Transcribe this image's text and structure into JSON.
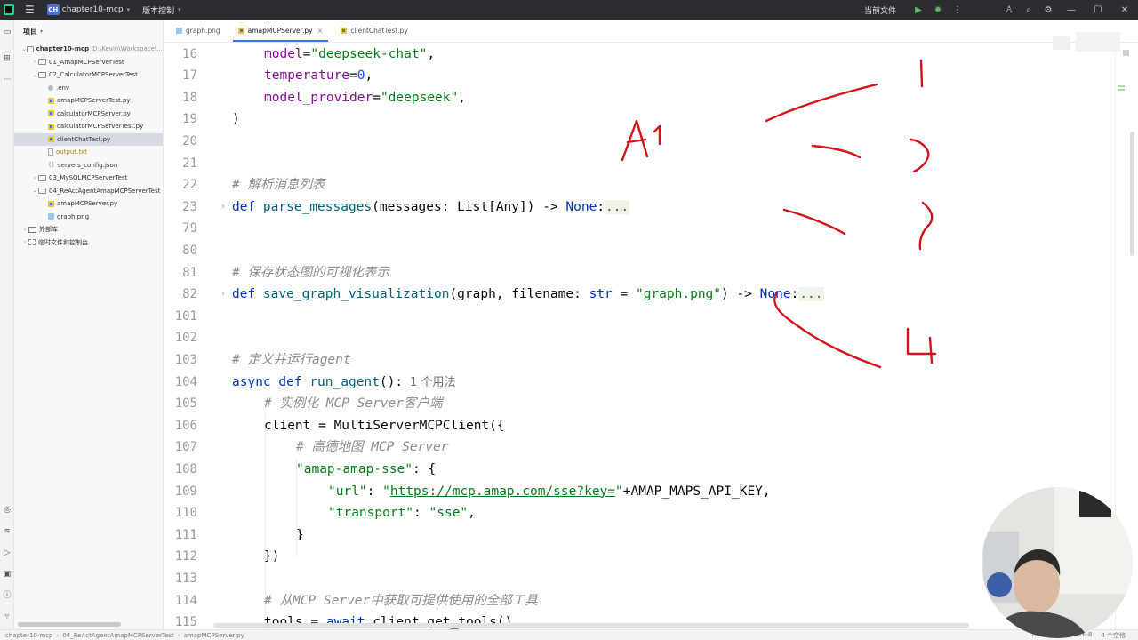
{
  "titlebar": {
    "project_badge": "CH",
    "project_name": "chapter10-mcp",
    "vcs_label": "版本控制",
    "run_config": "当前文件"
  },
  "project_panel": {
    "title": "项目",
    "tree": [
      {
        "label": "chapter10-mcp",
        "path": "D:\\Kevin\\Workspace\\...",
        "type": "folder",
        "level": 0,
        "expanded": true,
        "bold": true
      },
      {
        "label": "01_AmapMCPServerTest",
        "type": "folder",
        "level": 1,
        "expanded": false
      },
      {
        "label": "02_CalculatorMCPServerTest",
        "type": "folder",
        "level": 1,
        "expanded": true
      },
      {
        "label": ".env",
        "type": "env",
        "level": 2
      },
      {
        "label": "amapMCPServerTest.py",
        "type": "py",
        "level": 2
      },
      {
        "label": "calculatorMCPServer.py",
        "type": "py",
        "level": 2
      },
      {
        "label": "calculatorMCPServerTest.py",
        "type": "py",
        "level": 2
      },
      {
        "label": "clientChatTest.py",
        "type": "py",
        "level": 2,
        "selected": true
      },
      {
        "label": "output.txt",
        "type": "txt",
        "level": 2
      },
      {
        "label": "servers_config.json",
        "type": "json",
        "level": 2
      },
      {
        "label": "03_MySQLMCPServerTest",
        "type": "folder",
        "level": 1,
        "expanded": false
      },
      {
        "label": "04_ReActAgentAmapMCPServerTest",
        "type": "folder",
        "level": 1,
        "expanded": true
      },
      {
        "label": "amapMCPServer.py",
        "type": "py",
        "level": 2
      },
      {
        "label": "graph.png",
        "type": "png",
        "level": 2
      },
      {
        "label": "外部库",
        "type": "lib",
        "level": 0,
        "expanded": false
      },
      {
        "label": "临时文件和控制台",
        "type": "scratch",
        "level": 0,
        "expanded": false
      }
    ]
  },
  "tabs": [
    {
      "label": "graph.png",
      "type": "png",
      "active": false
    },
    {
      "label": "amapMCPServer.py",
      "type": "py",
      "active": true
    },
    {
      "label": "clientChatTest.py",
      "type": "py",
      "active": false
    }
  ],
  "editor": {
    "lines": [
      {
        "n": "16",
        "indent": 1,
        "tokens": [
          [
            "p",
            "model"
          ],
          [
            "t",
            "="
          ],
          [
            "s",
            "\"deepseek-chat\""
          ],
          [
            "t",
            ","
          ]
        ]
      },
      {
        "n": "17",
        "indent": 1,
        "tokens": [
          [
            "p",
            "temperature"
          ],
          [
            "t",
            "="
          ],
          [
            "n",
            "0"
          ],
          [
            "t",
            ","
          ]
        ]
      },
      {
        "n": "18",
        "indent": 1,
        "tokens": [
          [
            "p",
            "model_provider"
          ],
          [
            "t",
            "="
          ],
          [
            "s",
            "\"deepseek\""
          ],
          [
            "t",
            ","
          ]
        ]
      },
      {
        "n": "19",
        "indent": 0,
        "tokens": [
          [
            "t",
            ")"
          ]
        ]
      },
      {
        "n": "20",
        "indent": 0,
        "tokens": []
      },
      {
        "n": "21",
        "indent": 0,
        "tokens": []
      },
      {
        "n": "22",
        "indent": 0,
        "tokens": [
          [
            "c",
            "# 解析消息列表"
          ]
        ]
      },
      {
        "n": "23",
        "indent": 0,
        "fold": true,
        "tokens": [
          [
            "k",
            "def "
          ],
          [
            "f",
            "parse_messages"
          ],
          [
            "t",
            "(messages: List[Any]) -> "
          ],
          [
            "k",
            "None"
          ],
          [
            "t",
            ":"
          ],
          [
            "d",
            "..."
          ]
        ]
      },
      {
        "n": "79",
        "indent": 0,
        "tokens": []
      },
      {
        "n": "80",
        "indent": 0,
        "tokens": []
      },
      {
        "n": "81",
        "indent": 0,
        "tokens": [
          [
            "c",
            "# 保存状态图的可视化表示"
          ]
        ]
      },
      {
        "n": "82",
        "indent": 0,
        "fold": true,
        "tokens": [
          [
            "k",
            "def "
          ],
          [
            "f",
            "save_graph_visualization"
          ],
          [
            "t",
            "(graph, filename: "
          ],
          [
            "k",
            "str"
          ],
          [
            "t",
            " = "
          ],
          [
            "s",
            "\"graph.png\""
          ],
          [
            "t",
            ") -> "
          ],
          [
            "k",
            "None"
          ],
          [
            "t",
            ":"
          ],
          [
            "d",
            "..."
          ]
        ]
      },
      {
        "n": "101",
        "indent": 0,
        "tokens": []
      },
      {
        "n": "102",
        "indent": 0,
        "tokens": []
      },
      {
        "n": "103",
        "indent": 0,
        "tokens": [
          [
            "c",
            "# 定义并运行agent"
          ]
        ]
      },
      {
        "n": "104",
        "indent": 0,
        "tokens": [
          [
            "k",
            "async def "
          ],
          [
            "f",
            "run_agent"
          ],
          [
            "t",
            "():"
          ],
          [
            "h",
            "1 个用法"
          ]
        ]
      },
      {
        "n": "105",
        "indent": 1,
        "tokens": [
          [
            "c",
            "# 实例化 MCP Server客户端"
          ]
        ]
      },
      {
        "n": "106",
        "indent": 1,
        "tokens": [
          [
            "t",
            "client = MultiServerMCPClient({"
          ]
        ]
      },
      {
        "n": "107",
        "indent": 2,
        "tokens": [
          [
            "c",
            "# 高德地图 MCP Server"
          ]
        ]
      },
      {
        "n": "108",
        "indent": 2,
        "tokens": [
          [
            "s",
            "\"amap-amap-sse\""
          ],
          [
            "t",
            ": {"
          ]
        ]
      },
      {
        "n": "109",
        "indent": 3,
        "tokens": [
          [
            "s",
            "\"url\""
          ],
          [
            "t",
            ": "
          ],
          [
            "s",
            "\""
          ],
          [
            "l",
            "https://mcp.amap.com/sse?key="
          ],
          [
            "s",
            "\""
          ],
          [
            "t",
            "+AMAP_MAPS_API_KEY,"
          ]
        ]
      },
      {
        "n": "110",
        "indent": 3,
        "tokens": [
          [
            "s",
            "\"transport\""
          ],
          [
            "t",
            ": "
          ],
          [
            "s",
            "\"sse\""
          ],
          [
            "t",
            ","
          ]
        ]
      },
      {
        "n": "111",
        "indent": 2,
        "tokens": [
          [
            "t",
            "}"
          ]
        ]
      },
      {
        "n": "112",
        "indent": 1,
        "tokens": [
          [
            "t",
            "})"
          ]
        ]
      },
      {
        "n": "113",
        "indent": 0,
        "tokens": []
      },
      {
        "n": "114",
        "indent": 1,
        "tokens": [
          [
            "c",
            "# 从MCP Server中获取可提供使用的全部工具"
          ]
        ]
      },
      {
        "n": "115",
        "indent": 1,
        "tokens": [
          [
            "t",
            "tools = "
          ],
          [
            "k",
            "await "
          ],
          [
            "t",
            "client.get_tools()"
          ]
        ]
      }
    ]
  },
  "annotations": {
    "label_a1": "A1",
    "mark_1": "1",
    "mark_2": "2",
    "mark_3": "3",
    "mark_4": "4",
    "ink_color": "#d4141b"
  },
  "statusbar": {
    "crumbs": [
      "chapter10-mcp",
      "04_ReActAgentAmapMCPServerTest",
      "amapMCPServer.py"
    ],
    "right": [
      "1:1",
      "CRLF",
      "UTF-8",
      "4 个空格"
    ]
  },
  "colors": {
    "accent": "#3574f0",
    "keyword": "#0033b3",
    "string": "#067d17",
    "comment": "#8c8c8c"
  }
}
